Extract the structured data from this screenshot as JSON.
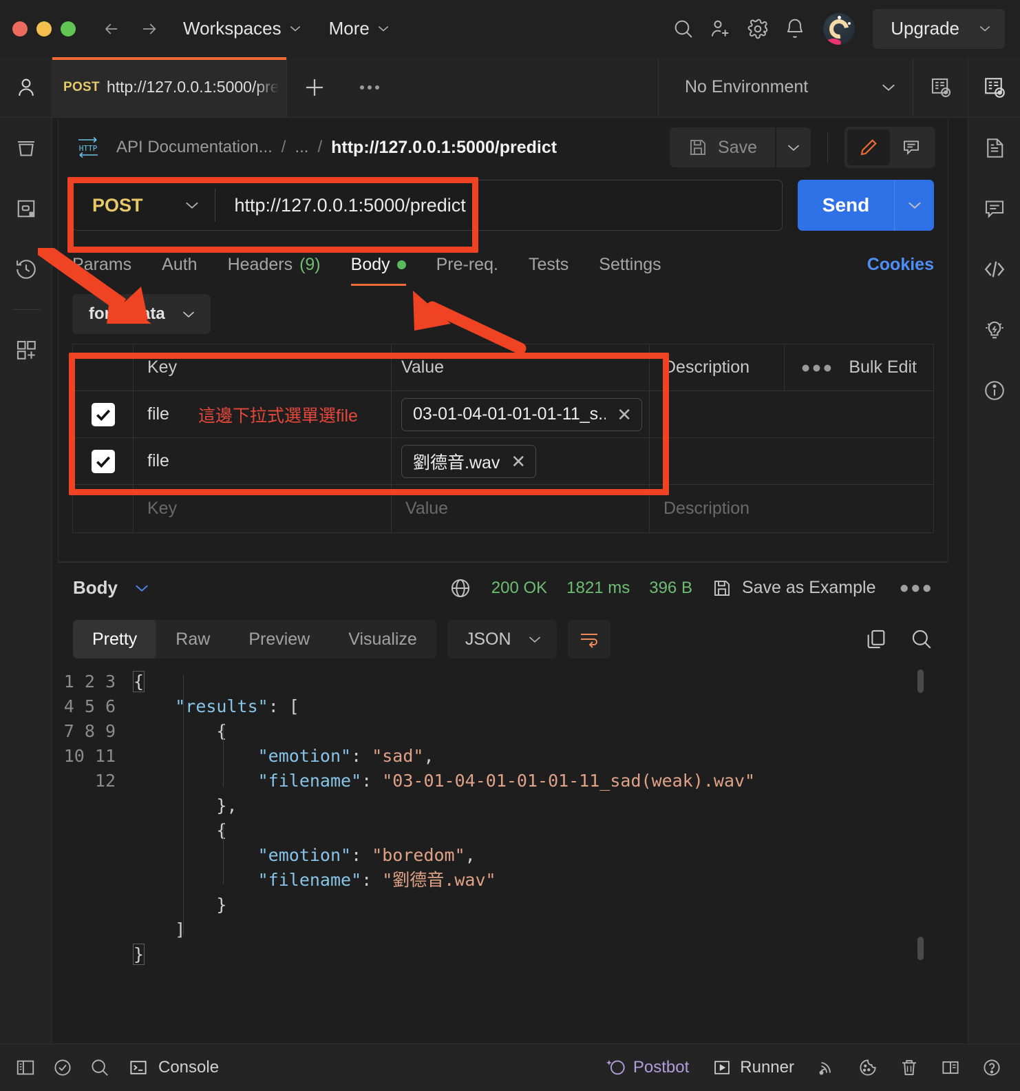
{
  "titlebar": {
    "back_icon": "arrow-left-icon",
    "forward_icon": "arrow-right-icon",
    "workspaces_label": "Workspaces",
    "more_label": "More",
    "search_icon": "search-icon",
    "invite_icon": "invite-user-icon",
    "settings_icon": "gear-icon",
    "notifications_icon": "bell-icon",
    "avatar": "user-avatar",
    "upgrade_label": "Upgrade"
  },
  "leftrail": {
    "items": [
      {
        "icon": "user-icon",
        "name": "profile"
      },
      {
        "icon": "collections-icon",
        "name": "collections"
      },
      {
        "icon": "apis-icon",
        "name": "apis"
      },
      {
        "icon": "history-icon",
        "name": "history"
      },
      {
        "icon": "new-grid-icon",
        "name": "add-module"
      }
    ]
  },
  "rightrail": {
    "items": [
      {
        "icon": "environment-quick-look-icon",
        "name": "environment-quick-look"
      },
      {
        "icon": "documentation-icon",
        "name": "documentation"
      },
      {
        "icon": "comments-icon",
        "name": "comments"
      },
      {
        "icon": "code-icon",
        "name": "code-snippet"
      },
      {
        "icon": "bulb-icon",
        "name": "info-tips"
      },
      {
        "icon": "info-icon",
        "name": "request-info"
      }
    ]
  },
  "tabstrip": {
    "request_tab": {
      "method": "POST",
      "url": "http://127.0.0.1:5000/pre"
    },
    "new_tab_icon": "plus-icon",
    "tab_options_icon": "more-dots-icon",
    "environment": "No Environment",
    "env_eye_icon": "environment-preview-icon"
  },
  "breadcrumb": {
    "protocol_badge": "HTTP",
    "collection": "API Documentation...",
    "ellipsis": "...",
    "current": "http://127.0.0.1:5000/predict",
    "save_label": "Save",
    "save_icon": "floppy-disk-icon",
    "save_caret_icon": "chevron-down-icon",
    "edit_icon": "pencil-icon",
    "comment_icon": "comment-icon"
  },
  "urlbar": {
    "method": "POST",
    "method_caret_icon": "chevron-down-icon",
    "url": "http://127.0.0.1:5000/predict",
    "send_label": "Send",
    "send_caret_icon": "chevron-down-icon"
  },
  "request_tabs": {
    "items": [
      {
        "label": "Params",
        "count": "",
        "active": false,
        "dot": false
      },
      {
        "label": "Auth",
        "count": "",
        "active": false,
        "dot": false
      },
      {
        "label": "Headers",
        "count": "(9)",
        "active": false,
        "dot": false
      },
      {
        "label": "Body",
        "count": "",
        "active": true,
        "dot": true
      },
      {
        "label": "Pre-req.",
        "count": "",
        "active": false,
        "dot": false
      },
      {
        "label": "Tests",
        "count": "",
        "active": false,
        "dot": false
      },
      {
        "label": "Settings",
        "count": "",
        "active": false,
        "dot": false
      }
    ],
    "cookies_label": "Cookies"
  },
  "body": {
    "type_label": "form-data",
    "type_caret_icon": "chevron-down-icon",
    "table": {
      "headers": {
        "key": "Key",
        "value": "Value",
        "description": "Description"
      },
      "bulk_edit_label": "Bulk Edit",
      "bulk_dots_icon": "more-dots-icon",
      "rows": [
        {
          "checked": true,
          "key": "file",
          "key_note": "這邊下拉式選單選file",
          "value": "03-01-04-01-01-01-11_s...",
          "value_clear_icon": "close-icon",
          "description": ""
        },
        {
          "checked": true,
          "key": "file",
          "key_note": "",
          "value": "劉德音.wav",
          "value_clear_icon": "close-icon",
          "description": ""
        }
      ],
      "placeholder_row": {
        "key": "Key",
        "value": "Value",
        "description": "Description"
      }
    }
  },
  "response": {
    "body_label": "Body",
    "body_caret_icon": "chevron-down-icon",
    "network_icon": "globe-icon",
    "status": "200 OK",
    "time": "1821 ms",
    "size": "396 B",
    "save_example_label": "Save as Example",
    "save_example_icon": "floppy-disk-icon",
    "more_icon": "more-dots-icon",
    "views": [
      "Pretty",
      "Raw",
      "Preview",
      "Visualize"
    ],
    "active_view": "Pretty",
    "format": "JSON",
    "format_caret_icon": "chevron-down-icon",
    "wrap_icon": "wrap-lines-icon",
    "copy_icon": "copy-icon",
    "search_icon": "search-icon",
    "line_numbers": [
      "1",
      "2",
      "3",
      "4",
      "5",
      "6",
      "7",
      "8",
      "9",
      "10",
      "11",
      "12"
    ],
    "json": {
      "results": [
        {
          "emotion": "sad",
          "filename": "03-01-04-01-01-01-11_sad(weak).wav"
        },
        {
          "emotion": "boredom",
          "filename": "劉德音.wav"
        }
      ]
    }
  },
  "bottombar": {
    "sidebar_icon": "toggle-sidebar-icon",
    "check_icon": "check-circle-icon",
    "find_icon": "search-icon",
    "console_label": "Console",
    "console_icon": "terminal-icon",
    "postbot_label": "Postbot",
    "postbot_icon": "postbot-icon",
    "runner_label": "Runner",
    "runner_icon": "play-icon",
    "capture_icon": "capture-requests-icon",
    "cookies_icon": "cookie-icon",
    "trash_icon": "trash-icon",
    "layout_icon": "two-pane-icon",
    "help_icon": "help-icon"
  },
  "annotations": {
    "url_box": "red-highlight-box",
    "table_box": "red-highlight-box",
    "arrow_to_formdata": "red-arrow",
    "arrow_to_body_tab": "red-arrow"
  },
  "colors": {
    "accent_orange": "#ef6c37",
    "annotation_red": "#ef4324",
    "send_blue": "#2f72e8",
    "status_green": "#6dbd72",
    "method_yellow": "#e7c96a",
    "link_blue": "#4f8ef7",
    "json_key": "#87c4e8",
    "json_string": "#e0a287"
  }
}
